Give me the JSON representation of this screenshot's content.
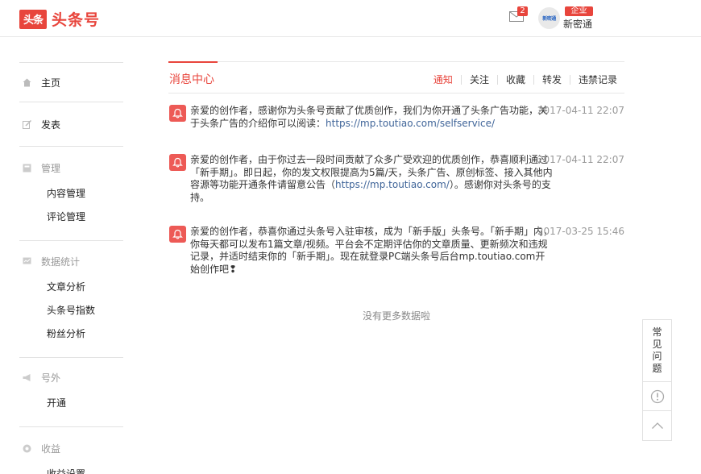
{
  "header": {
    "logo_mark": "头条",
    "logo_text": "头条号",
    "mail_count": "2",
    "avatar_text": "新密通",
    "enterprise_badge": "企业",
    "username": "新密通"
  },
  "sidebar": {
    "home": "主页",
    "publish": "发表",
    "manage": {
      "label": "管理",
      "items": [
        "内容管理",
        "评论管理"
      ]
    },
    "stats": {
      "label": "数据统计",
      "items": [
        "文章分析",
        "头条号指数",
        "粉丝分析"
      ]
    },
    "extra": {
      "label": "号外",
      "items": [
        "开通"
      ]
    },
    "income": {
      "label": "收益",
      "items": [
        "收益设置"
      ]
    }
  },
  "main": {
    "title": "消息中心",
    "tabs": [
      "通知",
      "关注",
      "收藏",
      "转发",
      "违禁记录"
    ],
    "active_tab": "通知",
    "messages": [
      {
        "text": "亲爱的创作者，感谢你为头条号贡献了优质创作，我们为你开通了头条广告功能，关于头条广告的介绍你可以阅读：",
        "link": "https://mp.toutiao.com/selfservice/",
        "suffix": "",
        "time": "2017-04-11 22:07"
      },
      {
        "text": "亲爱的创作者，由于你过去一段时间贡献了众多广受欢迎的优质创作，恭喜顺利通过「新手期」。即日起，你的发文权限提高为5篇/天，头条广告、原创标签、接入其他内容源等功能开通条件请留意公告（",
        "link": "https://mp.toutiao.com/",
        "suffix": "）。感谢你对头条号的支持。",
        "time": "2017-04-11 22:07"
      },
      {
        "text": "亲爱的创作者，恭喜你通过头条号入驻审核，成为「新手版」头条号。「新手期」内，你每天都可以发布1篇文章/视频。平台会不定期评估你的文章质量、更新频次和违规记录，并适时结束你的「新手期」。现在就登录PC端头条号后台mp.toutiao.com开始创作吧❢",
        "link": "",
        "suffix": "",
        "time": "2017-03-25 15:46"
      }
    ],
    "no_more": "没有更多数据啦"
  },
  "float_panel": {
    "faq": [
      "常",
      "见",
      "问",
      "题"
    ]
  },
  "colors": {
    "brand_red": "#e8453c",
    "link_blue": "#406599",
    "muted_gray": "#999999"
  },
  "icons": [
    "home-icon",
    "edit-icon",
    "manage-icon",
    "chart-icon",
    "megaphone-icon",
    "coin-icon",
    "mail-icon",
    "bell-icon",
    "feedback-icon",
    "back-to-top-icon"
  ]
}
